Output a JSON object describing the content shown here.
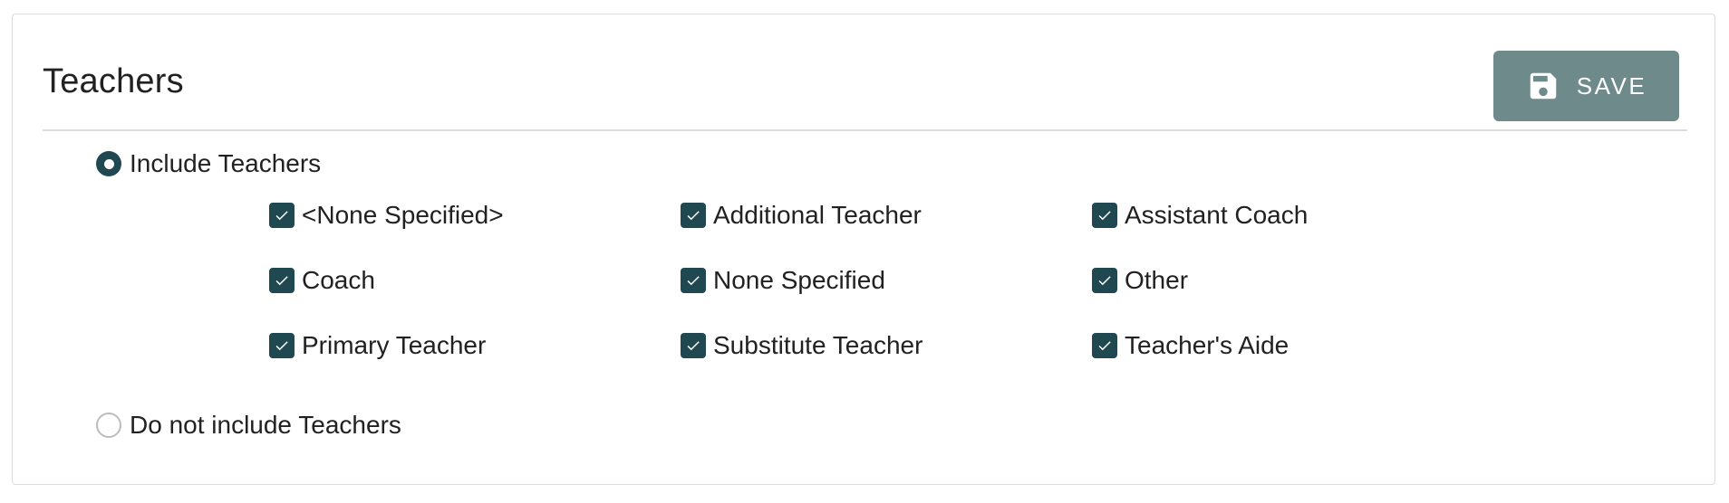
{
  "card": {
    "title": "Teachers"
  },
  "save_button": {
    "label": "SAVE",
    "icon": "floppy-disk-icon"
  },
  "options": {
    "include_label": "Include Teachers",
    "include_selected": true,
    "exclude_label": "Do not include Teachers",
    "exclude_selected": false
  },
  "teacher_types": [
    {
      "label": "<None Specified>",
      "checked": true
    },
    {
      "label": "Additional Teacher",
      "checked": true
    },
    {
      "label": "Assistant Coach",
      "checked": true
    },
    {
      "label": "Coach",
      "checked": true
    },
    {
      "label": "None Specified",
      "checked": true
    },
    {
      "label": "Other",
      "checked": true
    },
    {
      "label": "Primary Teacher",
      "checked": true
    },
    {
      "label": "Substitute Teacher",
      "checked": true
    },
    {
      "label": "Teacher's Aide",
      "checked": true
    }
  ],
  "colors": {
    "accent": "#1f4850",
    "save_button_bg": "#6e8a8a",
    "border": "#dcdcdc"
  }
}
